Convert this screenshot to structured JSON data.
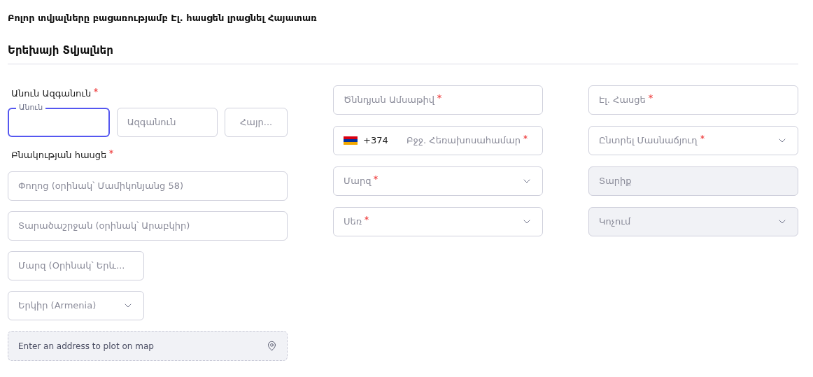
{
  "notice": "Բոլոր տվյալները բացառությամբ Էլ. հասցեն լրացնել Հայատառ",
  "section_title": "Երեխայի Տվյալներ",
  "name_label": {
    "text": "Անուն Ազգանուն",
    "required": true
  },
  "name_fields": [
    {
      "floating_label": "Անուն",
      "focused": true
    },
    {
      "placeholder": "Ազգանուն",
      "focused": false
    },
    {
      "placeholder": "Հայր...",
      "focused": false
    }
  ],
  "address_label": {
    "text": "Բնակության հասցե",
    "required": true
  },
  "address_fields": [
    {
      "kind": "text",
      "placeholder": "Փողոց (օրինակ՝ Մամիկոնյանց 58)"
    },
    {
      "kind": "text",
      "placeholder": "Տարածաշրջան (օրինակ՝ Արաբկիր)"
    },
    {
      "kind": "text",
      "placeholder": "Մարզ (Օրինակ՝ Երև..."
    },
    {
      "kind": "select",
      "placeholder": "Երկիր (Armenia)"
    }
  ],
  "map_field": {
    "placeholder": "Enter an address to plot on map"
  },
  "middle_fields": [
    {
      "kind": "text",
      "placeholder": "Ծննդյան Ամսաթիվ",
      "required": true,
      "disabled": false
    },
    {
      "kind": "phone",
      "code": "+374",
      "placeholder": "Բջջ. Հեռախոսահամար",
      "required": true,
      "disabled": false
    },
    {
      "kind": "select",
      "placeholder": "Մարզ",
      "required": true,
      "disabled": false
    },
    {
      "kind": "select",
      "placeholder": "Սեռ",
      "required": true,
      "disabled": false
    }
  ],
  "right_fields": [
    {
      "kind": "text",
      "placeholder": "Էլ. Հասցե",
      "required": true,
      "disabled": false
    },
    {
      "kind": "select",
      "placeholder": "Ընտրել Մասնաճյուղ",
      "required": true,
      "disabled": false
    },
    {
      "kind": "text",
      "placeholder": "Տարիք",
      "required": false,
      "disabled": true
    },
    {
      "kind": "select",
      "placeholder": "Կոչում",
      "required": false,
      "disabled": true
    }
  ]
}
